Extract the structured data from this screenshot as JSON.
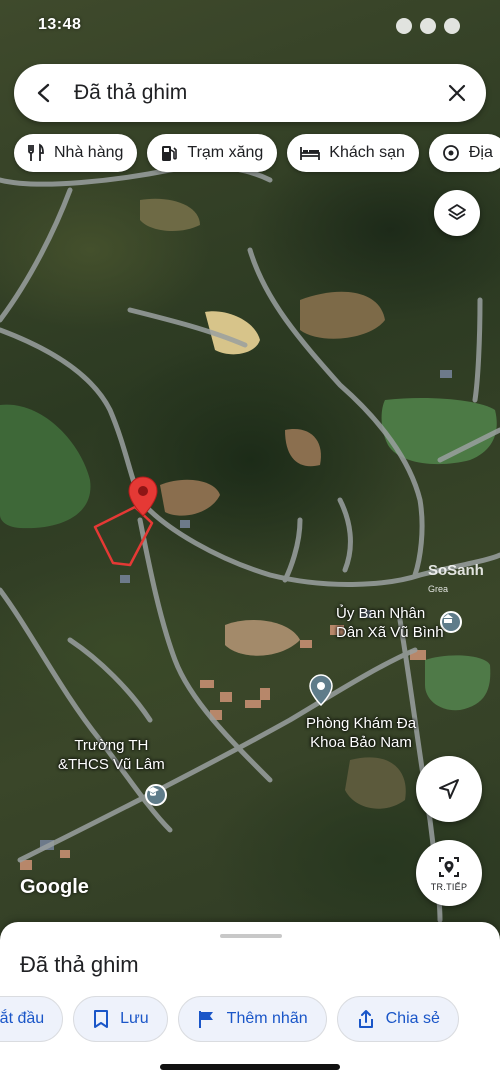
{
  "status_bar": {
    "time": "13:48"
  },
  "search": {
    "query": "Đã thả ghim"
  },
  "chips": [
    {
      "label": "Nhà hàng",
      "icon": "fork-knife-icon"
    },
    {
      "label": "Trạm xăng",
      "icon": "gas-station-icon"
    },
    {
      "label": "Khách sạn",
      "icon": "bed-icon"
    },
    {
      "label": "Địa",
      "icon": "attraction-icon"
    }
  ],
  "map": {
    "pois": [
      {
        "name_line1": "Ủy Ban Nhân",
        "name_line2": "Dân Xã Vũ Bình",
        "icon": "government-icon"
      },
      {
        "name_line1": "Phòng Khám Đa",
        "name_line2": "Khoa Bảo Nam",
        "icon": "place-pin-icon"
      },
      {
        "name_line1": "Trường TH",
        "name_line2": "&THCS Vũ Lâm",
        "icon": "school-icon"
      }
    ],
    "attribution": "Google",
    "watermark": "SoSanh",
    "watermark_sub": "Grea"
  },
  "buttons": {
    "directions_label": "TR.TIẾP"
  },
  "sheet": {
    "title": "Đã thả ghim",
    "actions": [
      {
        "label": "Bắt đầu",
        "icon": "navigation-icon"
      },
      {
        "label": "Lưu",
        "icon": "bookmark-icon"
      },
      {
        "label": "Thêm nhãn",
        "icon": "flag-icon"
      },
      {
        "label": "Chia sẻ",
        "icon": "share-icon"
      }
    ]
  },
  "colors": {
    "pin": "#e53935",
    "accent": "#1a56c8",
    "boundary": "#e53935"
  }
}
